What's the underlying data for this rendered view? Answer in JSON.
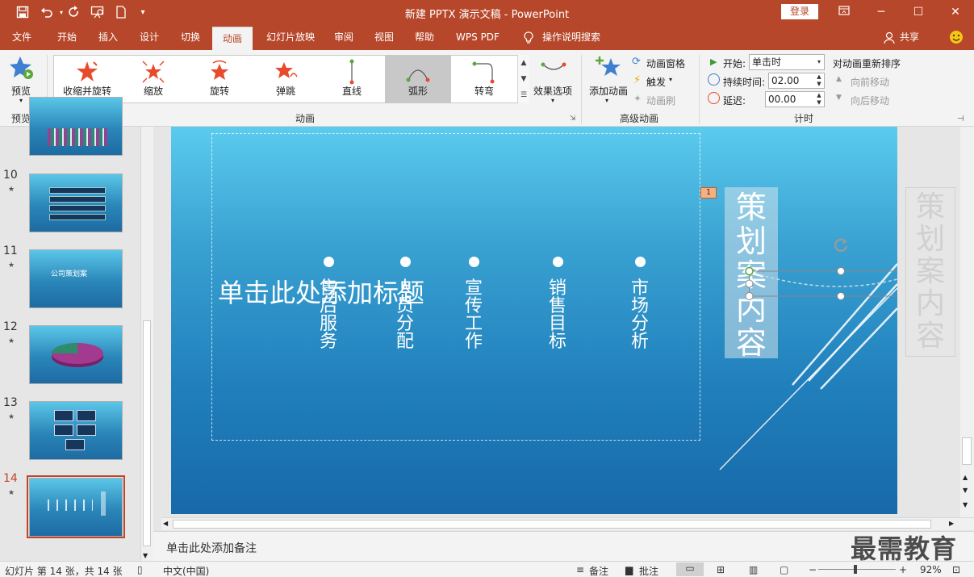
{
  "titlebar": {
    "title": "新建 PPTX 演示文稿  -  PowerPoint",
    "login": "登录",
    "qa_icons": [
      "save-icon",
      "undo-icon",
      "redo-icon",
      "present-from-start-icon",
      "new-file-icon",
      "customize-toolbar-icon"
    ]
  },
  "tabs": [
    "文件",
    "开始",
    "插入",
    "设计",
    "切换",
    "动画",
    "幻灯片放映",
    "审阅",
    "视图",
    "帮助",
    "WPS PDF",
    "操作说明搜索"
  ],
  "share": "共享",
  "ribbon": {
    "preview": "预览",
    "preview_group": "预览",
    "animations": [
      "收缩并旋转",
      "缩放",
      "旋转",
      "弹跳",
      "直线",
      "弧形",
      "转弯"
    ],
    "selected_animation": "弧形",
    "effect_options": "效果选项",
    "animation_group": "动画",
    "add_animation": "添加动画",
    "animation_pane": "动画窗格",
    "trigger": "触发",
    "animation_painter": "动画刷",
    "advanced_group": "高级动画",
    "start_label": "开始:",
    "start_value": "单击时",
    "duration_label": "持续时间:",
    "duration_value": "02.00",
    "delay_label": "延迟:",
    "delay_value": "00.00",
    "timing_group": "计时",
    "reorder": "对动画重新排序",
    "move_earlier": "向前移动",
    "move_later": "向后移动"
  },
  "thumbnails": [
    {
      "num": "10",
      "star": "★"
    },
    {
      "num": "11",
      "star": "★",
      "text": "公司策划案"
    },
    {
      "num": "12",
      "star": "★"
    },
    {
      "num": "13",
      "star": "★"
    },
    {
      "num": "14",
      "star": "★"
    }
  ],
  "slide": {
    "title_placeholder": "单击此处添加标题",
    "items": [
      "售后服务",
      "人员分配",
      "宣传工作",
      "销售目标",
      "市场分析"
    ],
    "vertical_title": "策划案内容",
    "ghost_title": "策划案内容",
    "animation_badge": "1"
  },
  "notes_placeholder": "单击此处添加备注",
  "watermark": "最需教育",
  "status": {
    "slide_info": "幻灯片 第 14 张，共 14 张",
    "language": "中文(中国)",
    "notes": "备注",
    "comments": "批注",
    "zoom": "92%"
  }
}
